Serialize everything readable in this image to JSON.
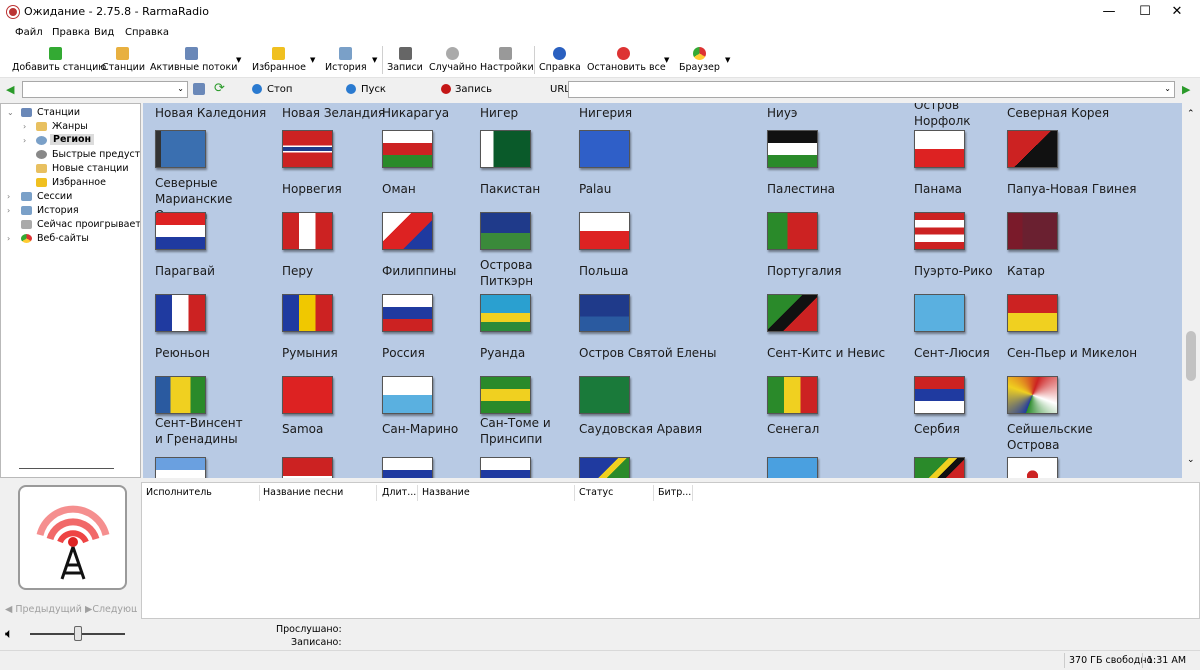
{
  "window": {
    "title": "Ожидание - 2.75.8 - RarmaRadio",
    "minimize": "—",
    "maximize": "☐",
    "close": "✕"
  },
  "menu": [
    "Файл",
    "Правка",
    "Вид",
    "Справка"
  ],
  "toolbar": {
    "add": "Добавить станцию",
    "stations": "Станции",
    "active": "Активные потоки",
    "favorites": "Избранное",
    "history": "История",
    "records": "Записи",
    "random": "Случайно",
    "settings": "Настройки",
    "help": "Справка",
    "stop_all": "Остановить все",
    "browser": "Браузер"
  },
  "addressbar": {
    "stop": "Стоп",
    "play": "Пуск",
    "record": "Запись",
    "url_label": "URL",
    "url_value": ""
  },
  "tree": {
    "stations": "Станции",
    "genres": "Жанры",
    "region": "Регион",
    "presets": "Быстрые предустано",
    "new": "Новые станции",
    "fav": "Избранное",
    "sessions": "Сессии",
    "history": "История",
    "now": "Сейчас проигрывается",
    "web": "Веб-сайты"
  },
  "grid": {
    "row1": [
      "Новая Каледония",
      "Новая Зеландия",
      "Никарагуа",
      "Нигер",
      "Нигерия",
      "Ниуэ",
      "Остров Норфолк",
      "Северная Корея"
    ],
    "row2": [
      "Северные Марианские Острова",
      "Норвегия",
      "Оман",
      "Пакистан",
      "Palau",
      "Палестина",
      "Панама",
      "Папуа-Новая Гвинея"
    ],
    "row3": [
      "Парагвай",
      "Перу",
      "Филиппины",
      "Острова Питкэрн",
      "Польша",
      "Португалия",
      "Пуэрто-Рико",
      "Катар"
    ],
    "row4": [
      "Реюньон",
      "Румыния",
      "Россия",
      "Руанда",
      "Остров Святой Елены",
      "Сент-Китс и Невис",
      "Сент-Люсия",
      "Сен-Пьер и Микелон"
    ],
    "row5": [
      "Сент-Винсент и Гренадины",
      "Samoa",
      "Сан-Марино",
      "Сан-Томе и Принсипи",
      "Саудовская Аравия",
      "Сенегал",
      "Сербия",
      "Сейшельские Острова"
    ]
  },
  "tracks": {
    "artist": "Исполнитель",
    "song": "Название песни",
    "length": "Длит...",
    "name": "Название",
    "status": "Статус",
    "bitrate": "Битр..."
  },
  "nav": {
    "prev": "Предыдущий",
    "next": "Следующий"
  },
  "info": {
    "listened": "Прослушано:",
    "recorded": "Записано:"
  },
  "statusbar": {
    "free": "370 ГБ свободно",
    "time": "1:31 AM"
  }
}
